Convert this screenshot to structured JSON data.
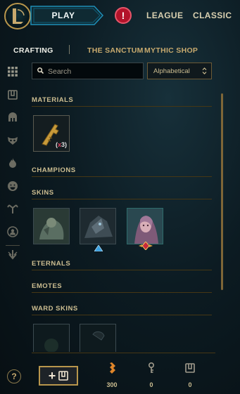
{
  "header": {
    "play_label": "PLAY",
    "alert_symbol": "!",
    "nav": [
      "LEAGUE",
      "CLASSIC"
    ]
  },
  "tabs": [
    "CRAFTING",
    "THE SANCTUM",
    "MYTHIC SHOP"
  ],
  "sidebar": {
    "icons": [
      "grid-icon",
      "chest-icon",
      "helmet-icon",
      "mask-icon",
      "flame-icon",
      "emote-icon",
      "tree-icon",
      "summoner-icon",
      "arrow-down-icon"
    ]
  },
  "search": {
    "placeholder": "Search",
    "value": ""
  },
  "sort": {
    "selected": "Alphabetical"
  },
  "sections": {
    "materials": "MATERIALS",
    "champions": "CHAMPIONS",
    "skins": "SKINS",
    "eternals": "ETERNALS",
    "emotes": "EMOTES",
    "ward_skins": "WARD SKINS"
  },
  "materials": [
    {
      "icon": "key-fragment-icon",
      "count": "3"
    }
  ],
  "skins": [
    {
      "icon": "skin-shard-1",
      "badge": ""
    },
    {
      "icon": "skin-shard-2",
      "badge": "blue"
    },
    {
      "icon": "skin-shard-3",
      "badge": "red"
    }
  ],
  "bottom": {
    "help_symbol": "?",
    "add_plus": "+",
    "currencies": [
      {
        "icon": "orange-essence-icon",
        "value": "300"
      },
      {
        "icon": "key-icon",
        "value": "0"
      },
      {
        "icon": "chest-icon",
        "value": "0"
      }
    ]
  },
  "colors": {
    "gold": "#c8aa6e",
    "accent_blue": "#1e8fb8",
    "alert_red": "#b3132a",
    "orange_essence": "#e0862a"
  }
}
